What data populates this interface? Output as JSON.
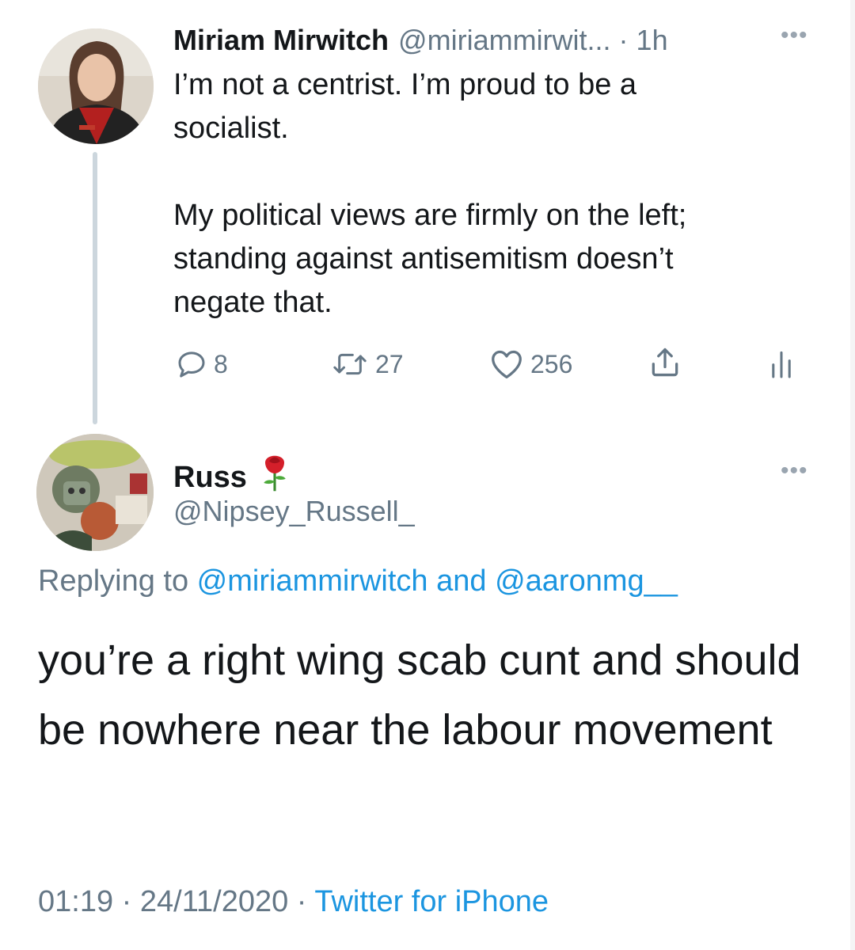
{
  "tweet1": {
    "author_name": "Miriam Mirwitch",
    "meta": "@miriammirwit... · 1h",
    "text": "I’m not a centrist. I’m proud to be a\nsocialist.\n\nMy political views are firmly on the left;\nstanding against antisemitism doesn’t\nnegate that.",
    "replies": "8",
    "retweets": "27",
    "likes": "256"
  },
  "tweet2": {
    "author_name": "Russ",
    "handle": "@Nipsey_Russell_",
    "replying_prefix": "Replying to ",
    "reply_user1": "@miriammirwitch",
    "reply_and": " and ",
    "reply_user2": "@aaronmg__",
    "text": "you’re a right wing scab cunt and should be nowhere near the labour movement",
    "time": "01:19",
    "sep1": " · ",
    "date": "24/11/2020",
    "sep2": " · ",
    "source": "Twitter for iPhone"
  },
  "colors": {
    "text": "#14171a",
    "secondary": "#657786",
    "link": "#1b95e0",
    "thread_line": "#ccd6dd"
  },
  "icons": [
    "reply-icon",
    "retweet-icon",
    "like-icon",
    "share-icon",
    "analytics-icon",
    "more-icon",
    "rose-emoji"
  ]
}
